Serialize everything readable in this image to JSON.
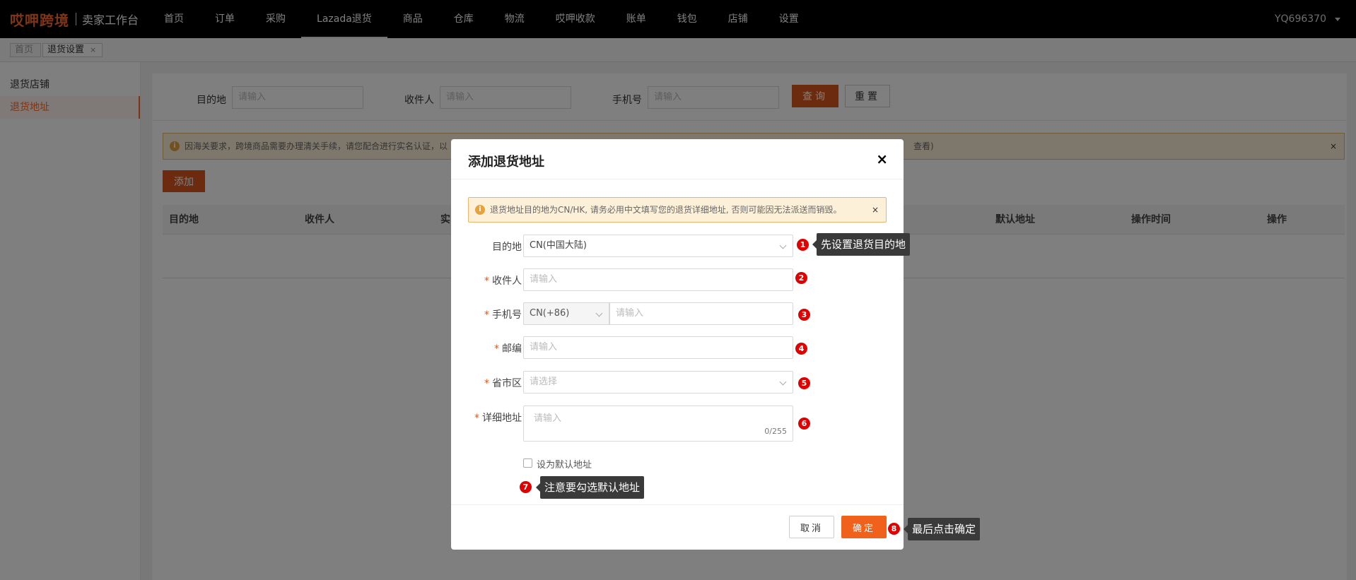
{
  "topbar": {
    "logo": "哎呷跨境",
    "subtitle": "卖家工作台",
    "nav": [
      "首页",
      "订单",
      "采购",
      "Lazada退货",
      "商品",
      "仓库",
      "物流",
      "哎呷收款",
      "账单",
      "钱包",
      "店铺",
      "设置"
    ],
    "active_nav": "Lazada退货",
    "user": "YQ696370"
  },
  "tabs": {
    "home": "首页",
    "current": "退货设置",
    "close": "×"
  },
  "sidebar": {
    "items": [
      "退货店铺",
      "退货地址"
    ],
    "active": "退货地址"
  },
  "filters": {
    "destination_label": "目的地",
    "recipient_label": "收件人",
    "phone_label": "手机号",
    "placeholder": "请输入",
    "query_button": "查询",
    "reset_button": "重置"
  },
  "notice": {
    "text": "因海关要求，跨境商品需要办理清关手续，请您配合进行实名认证，以",
    "tail": "查看)",
    "close": "×"
  },
  "add_button": "添加",
  "table": {
    "headers": [
      "目的地",
      "收件人",
      "实",
      "默认地址",
      "操作时间",
      "操作"
    ]
  },
  "modal": {
    "title": "添加退货地址",
    "close": "×",
    "warning": "退货地址目的地为CN/HK, 请务必用中文填写您的退货详细地址, 否则可能因无法派送而销毁。",
    "warning_close": "×",
    "fields": {
      "destination_label": "目的地",
      "destination_value": "CN(中国大陆)",
      "recipient_label": "收件人",
      "phone_label": "手机号",
      "phone_prefix": "CN(+86)",
      "zip_label": "邮编",
      "region_label": "省市区",
      "address_label": "详细地址",
      "input_placeholder": "请输入",
      "select_placeholder": "请选择",
      "address_counter": "0/255",
      "default_checkbox": "设为默认地址"
    },
    "cancel_button": "取消",
    "confirm_button": "确定"
  },
  "annotations": [
    {
      "num": "1",
      "text": "先设置退货目的地"
    },
    {
      "num": "2",
      "text": ""
    },
    {
      "num": "3",
      "text": ""
    },
    {
      "num": "4",
      "text": ""
    },
    {
      "num": "5",
      "text": ""
    },
    {
      "num": "6",
      "text": ""
    },
    {
      "num": "7",
      "text": "注意要勾选默认地址"
    },
    {
      "num": "8",
      "text": "最后点击确定"
    }
  ],
  "colors": {
    "brand": "#ff6a2a",
    "primary_button": "#d9571f",
    "badge": "#e00000",
    "tooltip": "#3a3a3a"
  }
}
